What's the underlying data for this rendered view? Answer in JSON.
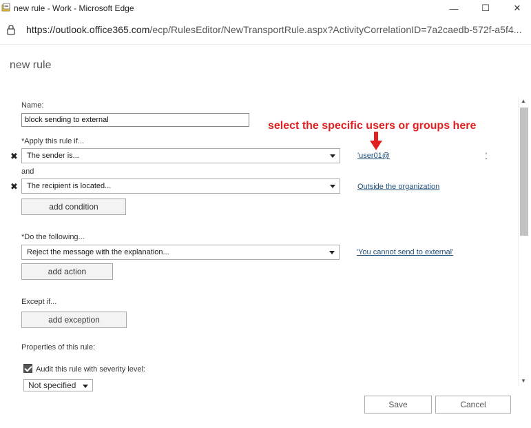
{
  "window": {
    "title": "new rule - Work - Microsoft Edge",
    "minimize_glyph": "—",
    "maximize_glyph": "☐",
    "close_glyph": "✕"
  },
  "address": {
    "url_host": "https://outlook.office365.com",
    "url_path": "/ecp/RulesEditor/NewTransportRule.aspx?ActivityCorrelationID=7a2caedb-572f-a5f4..."
  },
  "page": {
    "title": "new rule"
  },
  "form": {
    "name_label": "Name:",
    "name_value": "block sending to external",
    "apply_label": "*Apply this rule if...",
    "condition1": "The sender is...",
    "condition1_link": "'user01@",
    "condition1_link_tail": "'",
    "and_label": "and",
    "condition2": "The recipient is located...",
    "condition2_link": "Outside the organization",
    "add_condition": "add condition",
    "do_label": "*Do the following...",
    "action1": "Reject the message with the explanation...",
    "action1_link": "'You cannot send to external'",
    "add_action": "add action",
    "except_label": "Except if...",
    "add_exception": "add exception",
    "properties_label": "Properties of this rule:",
    "audit_label": "Audit this rule with severity level:",
    "audit_checked": true,
    "severity_value": "Not specified"
  },
  "annotation": {
    "text": "select the specific users or groups here",
    "color": "#e02020"
  },
  "footer": {
    "save": "Save",
    "cancel": "Cancel"
  },
  "icons": {
    "remove": "✖",
    "scroll_up": "▲",
    "scroll_down": "▼"
  }
}
